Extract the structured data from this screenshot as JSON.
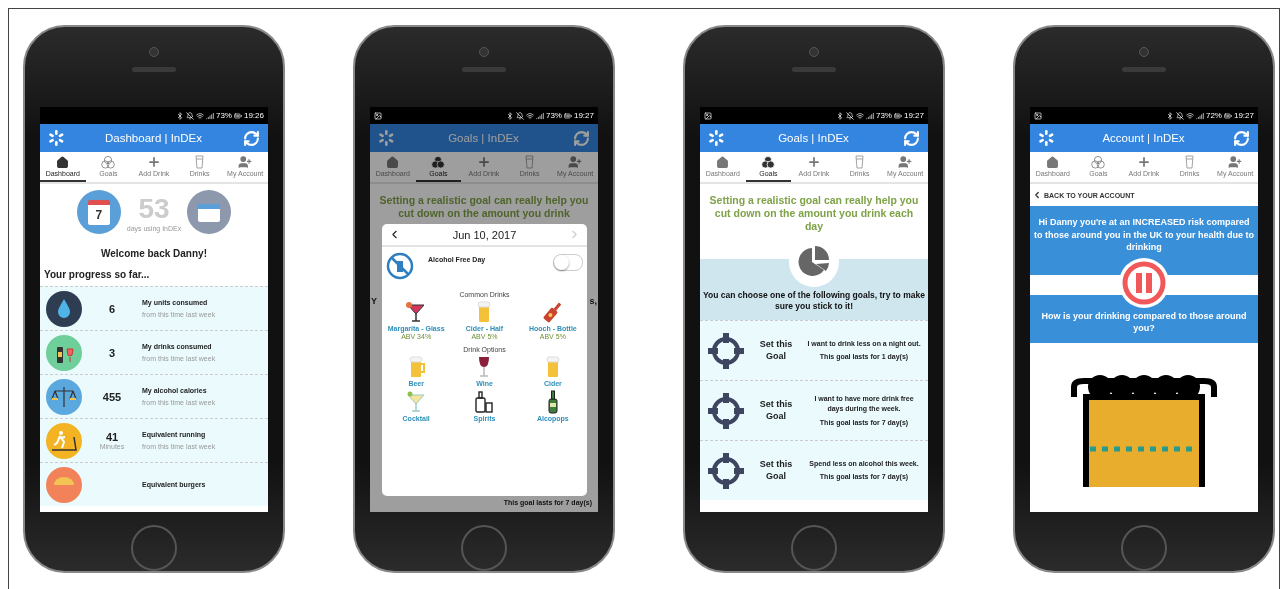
{
  "phones": [
    {
      "kind": "dashboard",
      "status": {
        "notification": false,
        "battery": "73%",
        "time": "19:26"
      },
      "title": "Dashboard | InDEx",
      "tabs": [
        {
          "label": "Dashboard",
          "selected": true
        },
        {
          "label": "Goals",
          "selected": false
        },
        {
          "label": "Add Drink",
          "selected": false
        },
        {
          "label": "Drinks",
          "selected": false
        },
        {
          "label": "My Account",
          "selected": false
        }
      ],
      "calendar_day": "7",
      "days_count": "53",
      "days_caption": "days using InDEx",
      "welcome": "Welcome back Danny!",
      "progress_heading": "Your progress so far...",
      "stats": [
        {
          "value": "6",
          "title": "My units consumed",
          "note": "from this time last week"
        },
        {
          "value": "3",
          "title": "My drinks consumed",
          "note": "from this time last week"
        },
        {
          "value": "455",
          "title": "My alcohol calories",
          "note": "from this time last week"
        },
        {
          "value": "41",
          "unit": "Minutes",
          "title": "Equivalent running",
          "note": "from this time last week"
        },
        {
          "title": "Equivalent burgers"
        }
      ]
    },
    {
      "kind": "add_drink_dialog",
      "status": {
        "notification": true,
        "battery": "73%",
        "time": "19:27"
      },
      "title": "Goals | InDEx",
      "tabs": [
        {
          "label": "Dashboard",
          "selected": false
        },
        {
          "label": "Goals",
          "selected": true
        },
        {
          "label": "Add Drink",
          "selected": false
        },
        {
          "label": "Drinks",
          "selected": false
        },
        {
          "label": "My Account",
          "selected": false
        }
      ],
      "intro": "Setting a realistic goal can really help you cut down on the amount you drink",
      "left_fragment": "Y",
      "right_fragment": "s,",
      "bottom_text": "This goal lasts for 7 day(s)",
      "dialog": {
        "date": "Jun 10, 2017",
        "next_disabled": true,
        "alcohol_free_label": "Alcohol Free Day",
        "alcohol_free_on": false,
        "common_heading": "Common Drinks",
        "common": [
          {
            "name": "Margarita - Glass",
            "abv": "ABV 34%"
          },
          {
            "name": "Cider - Half",
            "abv": "ABV 5%"
          },
          {
            "name": "Hooch - Bottle",
            "abv": "ABV 5%"
          }
        ],
        "options_heading": "Drink Options",
        "options": [
          {
            "name": "Beer"
          },
          {
            "name": "Wine"
          },
          {
            "name": "Cider"
          },
          {
            "name": "Cocktail"
          },
          {
            "name": "Spirits"
          },
          {
            "name": "Alcopops"
          }
        ]
      }
    },
    {
      "kind": "goals",
      "status": {
        "notification": true,
        "battery": "73%",
        "time": "19:27"
      },
      "title": "Goals | InDEx",
      "tabs": [
        {
          "label": "Dashboard",
          "selected": false
        },
        {
          "label": "Goals",
          "selected": true
        },
        {
          "label": "Add Drink",
          "selected": false
        },
        {
          "label": "Drinks",
          "selected": false
        },
        {
          "label": "My Account",
          "selected": false
        }
      ],
      "intro": "Setting a realistic goal can really help you cut down on the amount you drink each day",
      "prompt": "You can choose one of the following goals, try to make sure you stick to it!",
      "goals": [
        {
          "button": "Set this Goal",
          "description": "I want to drink less on a night out.",
          "duration": "This goal lasts for 1 day(s)"
        },
        {
          "button": "Set this Goal",
          "description": "I want to have more drink free days during the week.",
          "duration": "This goal lasts for 7 day(s)"
        },
        {
          "button": "Set this Goal",
          "description": "Spend less on alcohol this week.",
          "duration": "This goal lasts for 7 day(s)"
        }
      ]
    },
    {
      "kind": "account",
      "status": {
        "notification": true,
        "battery": "72%",
        "time": "19:27"
      },
      "title": "Account | InDEx",
      "tabs": [
        {
          "label": "Dashboard",
          "selected": false
        },
        {
          "label": "Goals",
          "selected": false
        },
        {
          "label": "Add Drink",
          "selected": false
        },
        {
          "label": "Drinks",
          "selected": false
        },
        {
          "label": "My Account",
          "selected": false
        }
      ],
      "back_link": "BACK TO YOUR ACCOUNT",
      "risk_text": "Hi Danny you're at an INCREASED risk compared to those around you in the UK to your health due to drinking",
      "question": "How is your drinking compared to those around you?"
    }
  ]
}
